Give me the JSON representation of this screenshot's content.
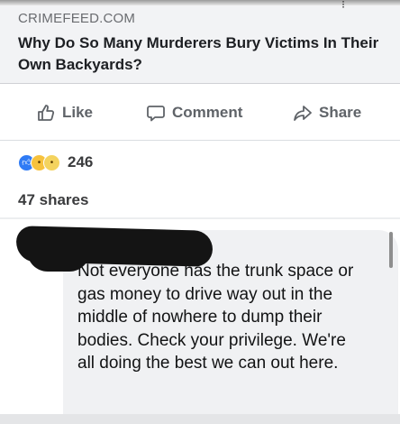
{
  "preview": {
    "domain": "CRIMEFEED.COM",
    "headline": "Why Do So Many Murderers Bury Victims In Their Own Backyards?"
  },
  "actions": {
    "like_label": "Like",
    "comment_label": "Comment",
    "share_label": "Share"
  },
  "engagement": {
    "reaction_count": "246",
    "shares": "47 shares"
  },
  "comment": {
    "text": "Not everyone has the trunk space or gas money to drive way out in the middle of nowhere to dump their bodies. Check your privilege. We're all doing the best we can out here."
  },
  "colors": {
    "reaction_like": "#2f7bf5",
    "reaction_emoji": "#f7c23d",
    "action_text": "#5f6368",
    "bubble": "#f0f1f3"
  },
  "icons": [
    "more-icon",
    "like-icon",
    "comment-icon",
    "share-icon",
    "like-reaction-icon",
    "wow-reaction-icon",
    "sad-reaction-icon"
  ]
}
